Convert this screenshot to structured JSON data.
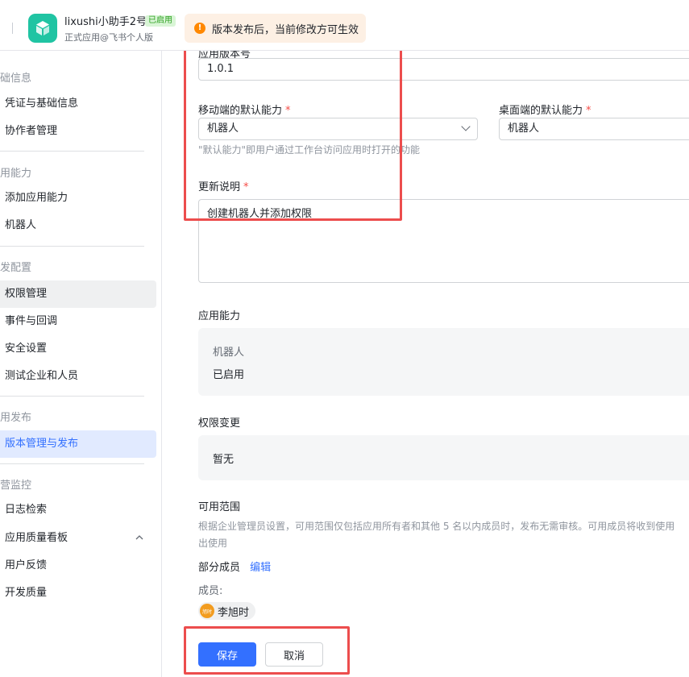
{
  "header": {
    "app_name": "lixushi小助手2号",
    "status_badge": "已启用",
    "app_subtitle": "正式应用@飞书个人版",
    "notice": "版本发布后，当前修改方可生效",
    "brand_color": "#20c4a3"
  },
  "sidebar": {
    "groups": {
      "basic": "础信息",
      "capability": "用能力",
      "dev_config": "发配置",
      "release": "用发布",
      "monitor": "营监控"
    },
    "items": {
      "credentials": "凭证与基础信息",
      "collaborators": "协作者管理",
      "add_capability": "添加应用能力",
      "bot": "机器人",
      "permissions": "权限管理",
      "events": "事件与回调",
      "security": "安全设置",
      "test_enterprise": "测试企业和人员",
      "version_release": "版本管理与发布",
      "log_search": "日志检索",
      "quality_board": "应用质量看板",
      "feedback": "用户反馈",
      "dev_quality": "开发质量"
    }
  },
  "form": {
    "version_label": "应用版本号",
    "version_value": "1.0.1",
    "mobile_default_label": "移动端的默认能力",
    "mobile_default_value": "机器人",
    "desktop_default_label": "桌面端的默认能力",
    "desktop_default_value": "机器人",
    "default_hint": "\"默认能力\"即用户通过工作台访问应用时打开的功能",
    "update_notes_label": "更新说明",
    "update_notes_value": "创建机器人并添加权限",
    "required_mark": "*",
    "app_capability_label": "应用能力",
    "capability_name": "机器人",
    "capability_status": "已启用",
    "permission_change_label": "权限变更",
    "permission_change_value": "暂无",
    "scope_label": "可用范围",
    "scope_hint_line1": "根据企业管理员设置，可用范围仅包括应用所有者和其他 5 名以内成员时，发布无需审核。可用成员将收到使用",
    "scope_hint_line2": "出使用",
    "partial_members": "部分成员",
    "edit_link": "编辑",
    "members_label": "成员:",
    "member_avatar_text": "旭时",
    "member_name": "李旭时",
    "save_button": "保存",
    "cancel_button": "取消"
  },
  "colors": {
    "primary": "#3370ff",
    "highlight_box": "#ec4d4d",
    "warning": "#ff8800"
  }
}
